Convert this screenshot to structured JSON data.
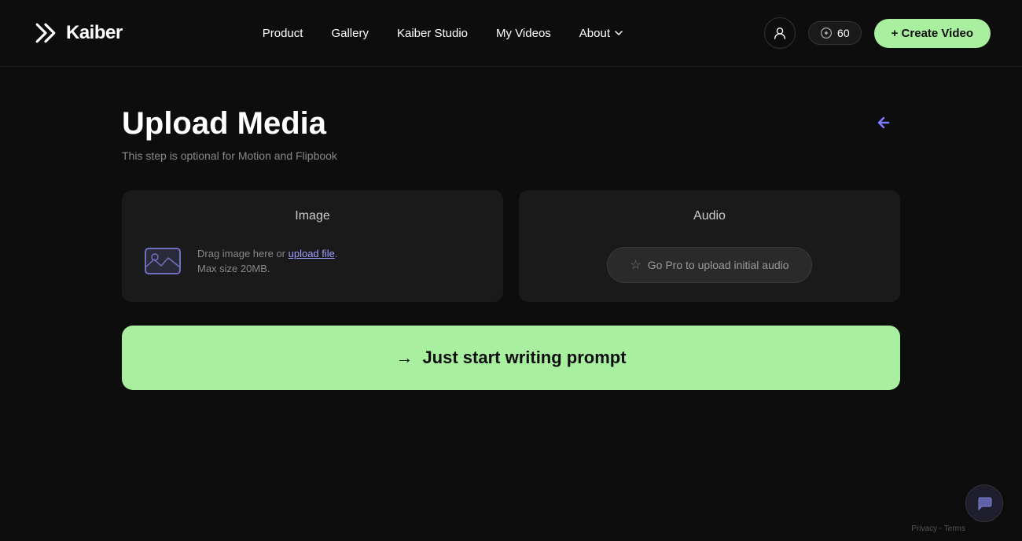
{
  "nav": {
    "logo_text": "Kaiber",
    "links": [
      {
        "label": "Product",
        "id": "product"
      },
      {
        "label": "Gallery",
        "id": "gallery"
      },
      {
        "label": "Kaiber Studio",
        "id": "kaiber-studio"
      },
      {
        "label": "My Videos",
        "id": "my-videos"
      },
      {
        "label": "About",
        "id": "about"
      }
    ],
    "credits_count": "60",
    "create_video_label": "+ Create Video"
  },
  "main": {
    "title": "Upload Media",
    "subtitle": "This step is optional for Motion and Flipbook",
    "image_card": {
      "title": "Image",
      "drag_text": "Drag image here or ",
      "upload_link": "upload file",
      "drag_text_suffix": ".",
      "max_size": "Max size 20MB."
    },
    "audio_card": {
      "title": "Audio",
      "go_pro_label": "Go Pro to upload initial audio"
    },
    "write_prompt": {
      "label": "Just start writing prompt",
      "arrow": "→"
    }
  },
  "chat": {
    "label": "Chat support"
  },
  "privacy": {
    "text": "Privacy - Terms"
  }
}
